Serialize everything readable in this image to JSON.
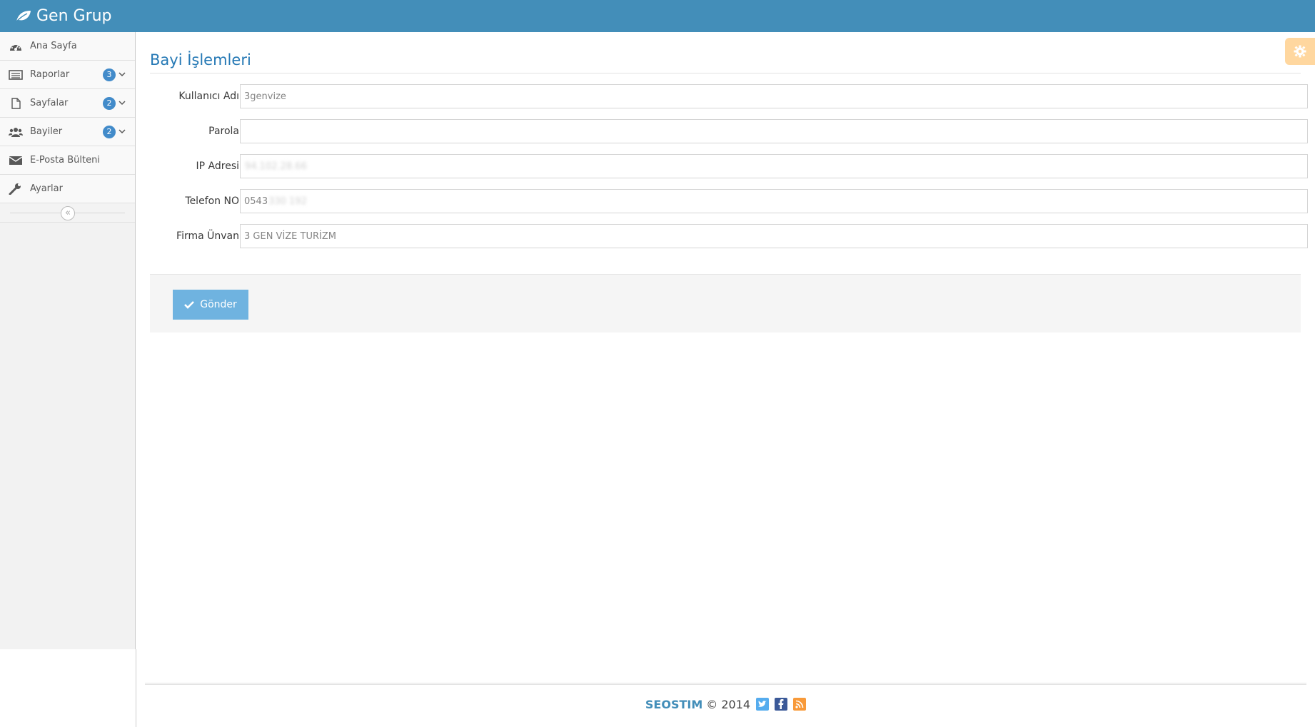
{
  "navbar": {
    "brand": "Gen Grup"
  },
  "sidebar": {
    "items": [
      {
        "label": "Ana Sayfa",
        "icon": "dashboard-icon"
      },
      {
        "label": "Raporlar",
        "icon": "list-icon",
        "badge": "3"
      },
      {
        "label": "Sayfalar",
        "icon": "file-icon",
        "badge": "2"
      },
      {
        "label": "Bayiler",
        "icon": "users-icon",
        "badge": "2"
      },
      {
        "label": "E-Posta Bülteni",
        "icon": "envelope-icon"
      },
      {
        "label": "Ayarlar",
        "icon": "wrench-icon"
      }
    ],
    "collapse_glyph": "«"
  },
  "main": {
    "title": "Bayi İşlemleri",
    "form": {
      "username_label": "Kullanıcı Adı",
      "username_value": "3genvize",
      "password_label": "Parola",
      "password_value": "",
      "ip_label": "IP Adresi",
      "ip_value_blurred": "94.102.28.66",
      "phone_label": "Telefon NO",
      "phone_value_prefix": "0543",
      "phone_value_blurred": "330 192",
      "company_label": "Firma Ünvan",
      "company_value": "3 GEN VİZE TURİZM",
      "submit_label": "Gönder"
    }
  },
  "footer": {
    "brand": "SEOSTIM",
    "copyright": "© 2014",
    "social": [
      {
        "icon": "twitter-icon",
        "color": "#55acee"
      },
      {
        "icon": "facebook-icon",
        "color": "#3b5998"
      },
      {
        "icon": "rss-icon",
        "color": "#f89a3a"
      }
    ]
  },
  "colors": {
    "navbar_bg": "#438eb9",
    "accent": "#2679b5",
    "badge": "#428bca",
    "submit_bg": "#6fb3e0",
    "settings_bg": "#ffb752"
  }
}
